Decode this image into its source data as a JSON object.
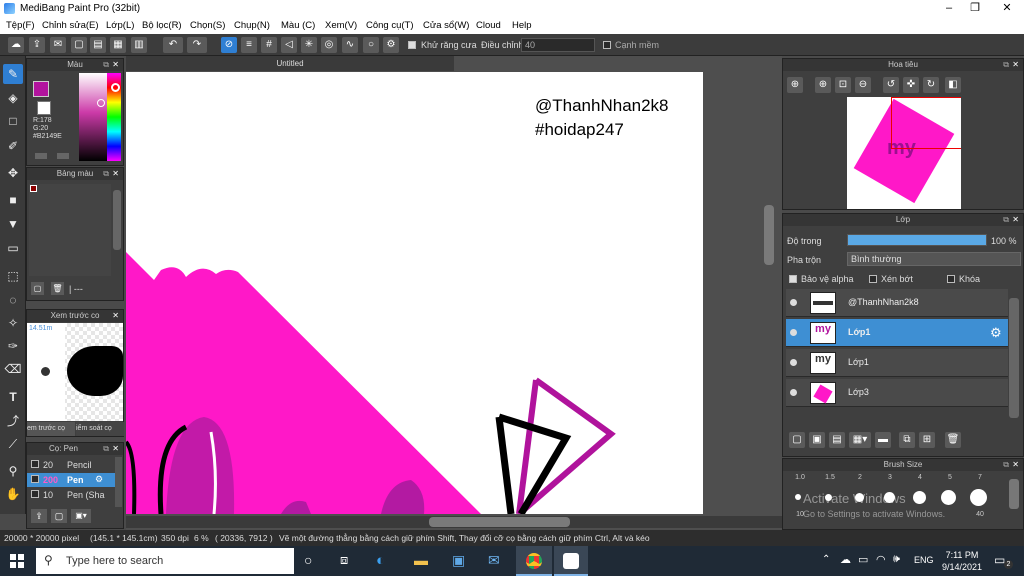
{
  "window": {
    "title": "MediBang Paint Pro (32bit)",
    "minimize": "–",
    "maximize": "❐",
    "close": "✕"
  },
  "menu": [
    "Tệp(F)",
    "Chỉnh sửa(E)",
    "Lớp(L)",
    "Bộ lọc(R)",
    "Chọn(S)",
    "Chụp(N)",
    "Màu (C)",
    "Xem(V)",
    "Công cụ(T)",
    "Cửa sổ(W)",
    "Cloud",
    "Help"
  ],
  "toolbar": {
    "antialias": "Khử răng cưa",
    "adjust": "Điều chỉnh",
    "adjust_value": "40",
    "smooth": "Cạnh mềm"
  },
  "color_panel": {
    "title": "Màu",
    "r": "R:178",
    "g": "G:20",
    "hex": "#B2149E",
    "fg": "#B2149E",
    "bg": "#ffffff"
  },
  "palette_panel": {
    "title": "Bảng màu",
    "footer": "| ---"
  },
  "preview_panel": {
    "title": "Xem trước co",
    "size": "14.51m",
    "tab1": "em trước cọ",
    "tab2": "iểm soát cọ"
  },
  "brush_panel": {
    "title": "Cọ: Pen",
    "items": [
      {
        "size": "20",
        "name": "Pencil"
      },
      {
        "size": "200",
        "name": "Pen"
      },
      {
        "size": "10",
        "name": "Pen (Sha"
      }
    ]
  },
  "canvas": {
    "tab": "Untitled",
    "line1": "@ThanhNhan2k8",
    "line2": "#hoidap247"
  },
  "navigator": {
    "title": "Hoa tiêu"
  },
  "layer_panel": {
    "title": "Lớp",
    "opacity_label": "Độ trong",
    "opacity_value": "100 %",
    "opacity": 1.0,
    "blend_label": "Pha trộn",
    "blend_value": "Bình thường",
    "protect_alpha": "Bảo vệ alpha",
    "clip": "Xén bớt",
    "lock": "Khóa",
    "layers": [
      {
        "name": "@ThanhNhan2k8"
      },
      {
        "name": "Lớp1"
      },
      {
        "name": "Lớp1"
      },
      {
        "name": "Lớp3"
      }
    ]
  },
  "brushsize_panel": {
    "title": "Brush Size",
    "sizes": [
      "1.0",
      "1.5",
      "2",
      "3",
      "4",
      "5",
      "7"
    ],
    "row2": [
      "10",
      "",
      "",
      "",
      "",
      "",
      "40"
    ],
    "watermark1": "Activate Windows",
    "watermark2": "Go to Settings to activate Windows."
  },
  "status": {
    "dims": "20000 * 20000 pixel",
    "cm": "(145.1 * 145.1cm)",
    "dpi": "350 dpi",
    "zoom": "6 %",
    "coords": "( 20336, 7912 )",
    "hint": "Vẽ một đường thẳng bằng cách giữ phím Shift, Thay đổi cỡ cọ bằng cách giữ phím Ctrl, Alt và kéo"
  },
  "taskbar": {
    "search_placeholder": "Type here to search",
    "time": "7:11 PM",
    "date": "9/14/2021",
    "lang": "ENG",
    "notif": "2"
  }
}
